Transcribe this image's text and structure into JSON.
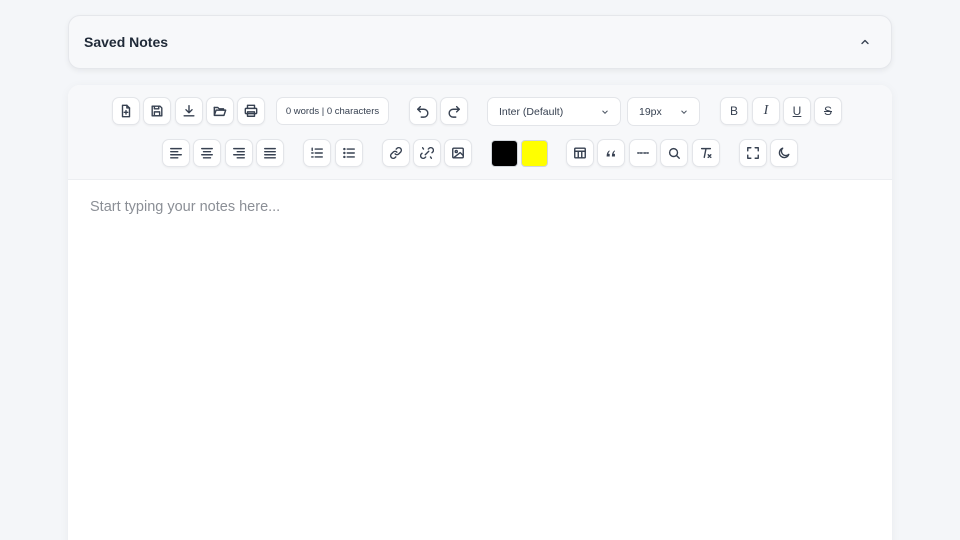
{
  "saved_notes": {
    "title": "Saved Notes",
    "collapse_icon": "chevron-up-icon"
  },
  "toolbar": {
    "row1": {
      "file_buttons": [
        "new-file-icon",
        "save-icon",
        "download-icon",
        "open-folder-icon",
        "print-icon"
      ],
      "counter": "0 words | 0 characters",
      "history_buttons": [
        "undo-icon",
        "redo-icon"
      ],
      "font_family": "Inter (Default)",
      "font_size": "19px",
      "format_buttons": [
        {
          "icon": "bold-icon",
          "label": "B"
        },
        {
          "icon": "italic-icon",
          "label": "I"
        },
        {
          "icon": "underline-icon",
          "label": "U"
        },
        {
          "icon": "strikethrough-icon",
          "label": "S"
        }
      ]
    },
    "row2": {
      "align_buttons": [
        "align-left-icon",
        "align-center-icon",
        "align-right-icon",
        "align-justify-icon"
      ],
      "list_buttons": [
        "ordered-list-icon",
        "bullet-list-icon"
      ],
      "link_buttons": [
        "link-icon",
        "unlink-icon",
        "image-icon"
      ],
      "text_color": "#000000",
      "highlight_color": "#ffff00",
      "insert_buttons": [
        "table-icon",
        "quote-icon",
        "horizontal-rule-icon",
        "find-icon",
        "clear-format-icon"
      ],
      "view_buttons": [
        "fullscreen-icon",
        "dark-mode-icon"
      ]
    }
  },
  "editor": {
    "placeholder": "Start typing your notes here..."
  }
}
